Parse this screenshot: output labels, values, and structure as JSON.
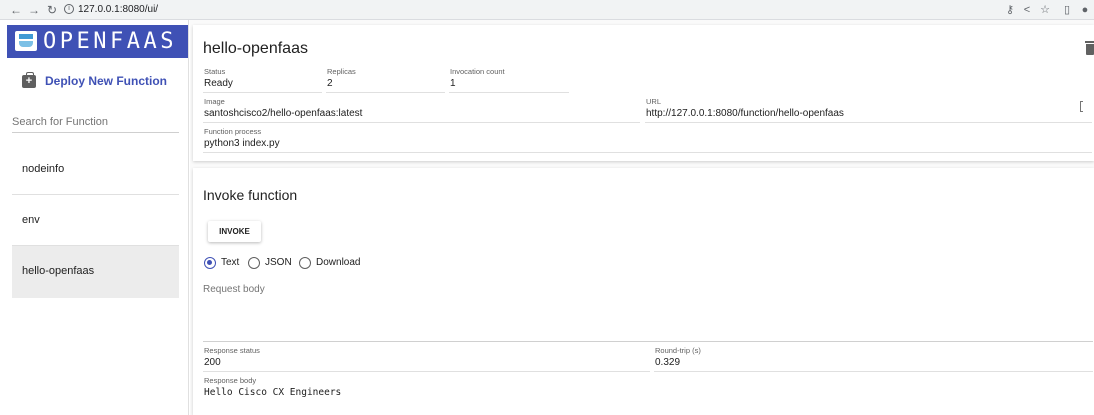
{
  "browser": {
    "url": "127.0.0.1:8080/ui/",
    "icons": [
      "back-arrow-icon",
      "forward-arrow-icon",
      "reload-icon",
      "key-icon",
      "share-icon",
      "star-icon",
      "sidebar-toggle-icon",
      "profile-icon"
    ]
  },
  "sidebar": {
    "logo_text": "OPENFAAS",
    "deploy_label": "Deploy New Function",
    "search_placeholder": "Search for Function",
    "functions": [
      {
        "label": "nodeinfo"
      },
      {
        "label": "env"
      },
      {
        "label": "hello-openfaas"
      }
    ],
    "selected": "hello-openfaas"
  },
  "function_details": {
    "name": "hello-openfaas",
    "status_label": "Status",
    "status": "Ready",
    "replicas_label": "Replicas",
    "replicas": "2",
    "invocation_label": "Invocation count",
    "invocation_count": "1",
    "image_label": "Image",
    "image": "santoshcisco2/hello-openfaas:latest",
    "url_label": "URL",
    "url": "http://127.0.0.1:8080/function/hello-openfaas",
    "process_label": "Function process",
    "process": "python3 index.py"
  },
  "invoke": {
    "title": "Invoke function",
    "button_label": "INVOKE",
    "formats": [
      "Text",
      "JSON",
      "Download"
    ],
    "selected_format": "Text",
    "request_placeholder": "Request body",
    "response_status_label": "Response status",
    "response_status": "200",
    "round_trip_label": "Round-trip (s)",
    "round_trip": "0.329",
    "response_body_label": "Response body",
    "response_body": "Hello Cisco CX Engineers"
  },
  "colors": {
    "brand": "#3f51b5",
    "selected_row": "#ececec"
  }
}
